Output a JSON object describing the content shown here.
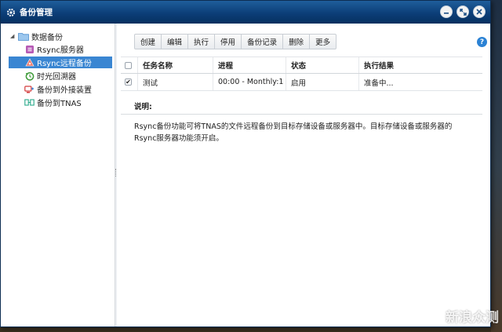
{
  "window": {
    "title": "备份管理"
  },
  "sidebar": {
    "root": {
      "label": "数据备份",
      "icon": "folder-icon"
    },
    "items": [
      {
        "label": "Rsync服务器",
        "icon": "rsync-server-icon",
        "selected": false
      },
      {
        "label": "Rsync远程备份",
        "icon": "remote-backup-icon",
        "selected": true
      },
      {
        "label": "时光回溯器",
        "icon": "time-machine-icon",
        "selected": false
      },
      {
        "label": "备份到外接装置",
        "icon": "external-device-icon",
        "selected": false
      },
      {
        "label": "备份到TNAS",
        "icon": "tnas-backup-icon",
        "selected": false
      }
    ]
  },
  "toolbar": {
    "buttons": [
      "创建",
      "编辑",
      "执行",
      "停用",
      "备份记录",
      "删除",
      "更多"
    ]
  },
  "help": {
    "label": "?"
  },
  "table": {
    "columns": [
      "任务名称",
      "进程",
      "状态",
      "执行结果"
    ],
    "rows": [
      {
        "checked": true,
        "name": "测试",
        "process": "00:00 - Monthly:1",
        "status": "启用",
        "result": "准备中..."
      }
    ]
  },
  "description": {
    "title": "说明:",
    "text": "Rsync备份功能可将TNAS的文件远程备份到目标存储设备或服务器中。目标存储设备或服务器的Rsync服务器功能须开启。"
  },
  "watermark": "新浪众测",
  "colors": {
    "titlebar": "#0c3e78",
    "selected": "#3a86d2",
    "help": "#2b82d4"
  }
}
